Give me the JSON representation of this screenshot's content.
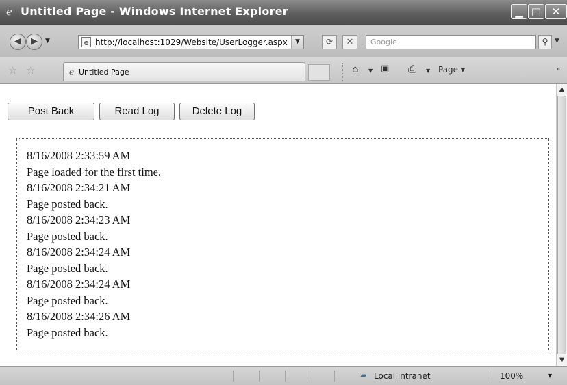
{
  "window": {
    "title": "Untitled Page - Windows Internet Explorer",
    "minimize_glyph": "▁",
    "maximize_glyph": "□",
    "close_glyph": "✕"
  },
  "address_bar": {
    "url": "http://localhost:1029/Website/UserLogger.aspx",
    "search_placeholder": "Google"
  },
  "tab": {
    "label": "Untitled Page"
  },
  "command_bar": {
    "page_label": "Page ▾"
  },
  "page": {
    "buttons": {
      "post_back": "Post Back",
      "read_log": "Read Log",
      "delete_log": "Delete Log"
    },
    "log_lines": [
      "8/16/2008 2:33:59 AM",
      "Page loaded for the first time.",
      "8/16/2008 2:34:21 AM",
      "Page posted back.",
      "8/16/2008 2:34:23 AM",
      "Page posted back.",
      "8/16/2008 2:34:24 AM",
      "Page posted back.",
      "8/16/2008 2:34:24 AM",
      "Page posted back.",
      "8/16/2008 2:34:26 AM",
      "Page posted back."
    ]
  },
  "status_bar": {
    "zone": "Local intranet",
    "zoom": "100%"
  }
}
